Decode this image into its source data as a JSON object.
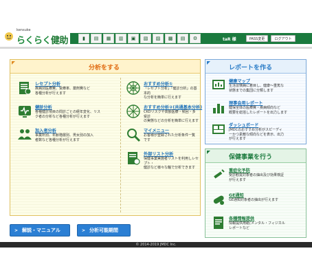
{
  "app": {
    "logo_small": "kensuke",
    "logo_hiragana": "らくらく",
    "logo_kanji": "健助"
  },
  "nav": {
    "icons": [
      "doc-icon",
      "chart-icon",
      "print-icon",
      "grid-icon",
      "table-icon",
      "file-icon",
      "folder-icon",
      "window-icon",
      "book-icon",
      "gear-icon"
    ]
  },
  "header": {
    "user": "taR 様",
    "pass_change": "PASS変更",
    "logout": "ログアウト"
  },
  "left_panel": {
    "title": "分析をする",
    "items_left": [
      {
        "title": "レセプト分析",
        "desc": "疾病別医療費、受療率、薬剤費など\n各種分析が行えます"
      },
      {
        "title": "健診分析",
        "desc": "各種健診項目の問診ごとの経年変化、リス\nク者の分析など各種分析が行えます"
      },
      {
        "title": "加入者分析",
        "desc": "事業所別、年齢階層別、男女別の加入\n者数など各種分析が行えます"
      }
    ],
    "items_right": [
      {
        "title": "おすすめ分析①",
        "desc": "「レセプト分析」「健診分析」の基本的\nな分析を簡単に行えます"
      },
      {
        "title": "おすすめ分析②(共通基本分析)",
        "desc": "CKDリスクや高額医療・頻回・多受診\nの実態などの分析を簡単に行えます"
      },
      {
        "title": "マイメニュー",
        "desc": "お客様が登録された分析条件一覧\nです"
      },
      {
        "title": "外部リスト分析",
        "desc": "保健事業実施者リストを利用しレセプト・\n健診など様々な軸で分析できます"
      }
    ]
  },
  "report_panel": {
    "title": "レポートを作る",
    "items": [
      {
        "title": "健康マップ",
        "desc": "生活習慣病に着目し、健康～重篤な\n状態までの集団に分類します"
      },
      {
        "title": "理事会用レポート",
        "desc": "健保全体の医療費・疾病傾向など\n概要を総括したレポートを出力します"
      },
      {
        "title": "ダッシュボード",
        "desc": "JMDCのおすすめ分析がスピーディ\nーかつ素敵な傾向などを表示、出力\nが行えます"
      }
    ]
  },
  "health_panel": {
    "title": "保健事業を行う",
    "items": [
      {
        "title": "重症化予防",
        "desc": "受診勧奨対象者の抽出及び効果検証\nが行えます"
      },
      {
        "title": "GE通知",
        "desc": "GE通知対象者の抽出が行えます"
      },
      {
        "title": "各種情報提供",
        "desc": "情報提供用紙(メンタル・フィジカル\nレポートなど"
      }
    ]
  },
  "buttons": {
    "manual": "解説・マニュアル",
    "period": "分析可能期間"
  },
  "footer": {
    "copyright": "© 2014-2019 JMDC Inc."
  },
  "colors": {
    "nav_green": "#1b7a3e",
    "orange_title": "#e06a10",
    "blue_title": "#2a7cc7",
    "green_title": "#1c7a3e",
    "button_blue": "#2b7fd4"
  }
}
